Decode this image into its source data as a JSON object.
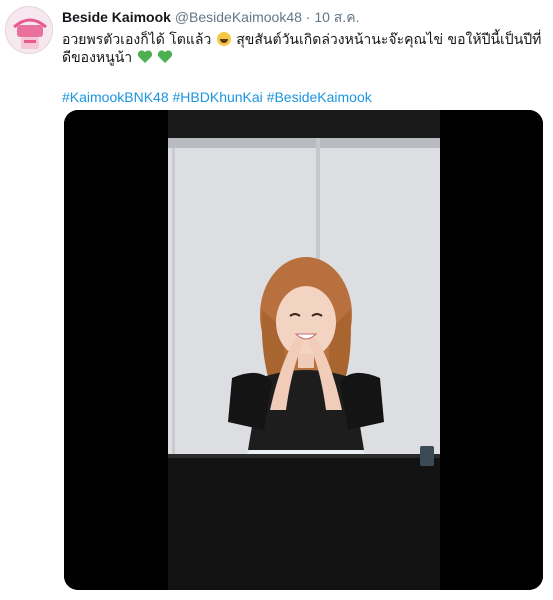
{
  "tweet": {
    "author": {
      "display_name": "Beside Kaimook",
      "handle": "@BesideKaimook48"
    },
    "separator": "·",
    "date": "10 ส.ค.",
    "text": {
      "part1": "อวยพรตัวเองก็ได้ โตแล้ว",
      "part2": " สุขสันต์วันเกิดล่วงหน้านะจ๊ะคุณไข่ ขอให้ปีนี้เป็นปีที่ดีของหนูน้า "
    },
    "emojis": [
      "grinning-squinting-face-icon",
      "green-heart-icon",
      "green-heart-icon"
    ],
    "hashtags": [
      "#KaimookBNK48",
      "#HBDKhunKai",
      "#BesideKaimook"
    ],
    "media": {
      "type": "video",
      "colors": {
        "letterbox": "#000000",
        "wall": "#dcdee1",
        "table": "#121212"
      }
    }
  },
  "colors": {
    "link": "#1b95e0",
    "text": "#14171a",
    "secondary": "#657786",
    "heart": "#4caf50"
  }
}
